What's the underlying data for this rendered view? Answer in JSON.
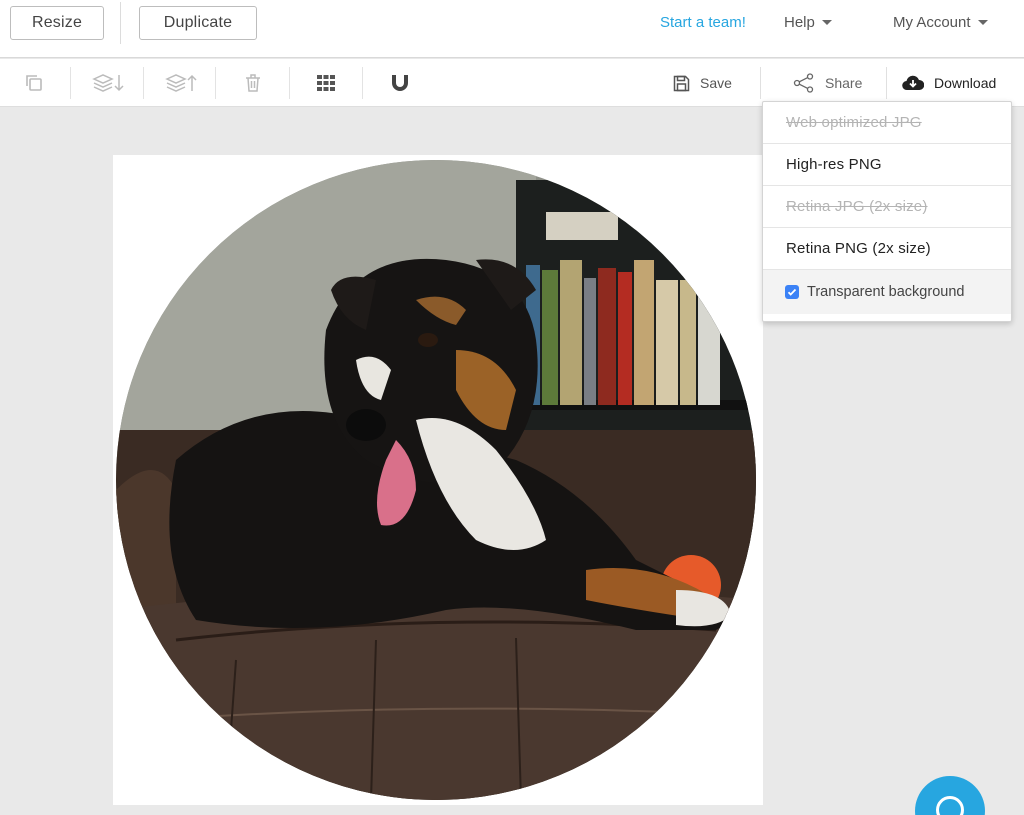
{
  "topbar": {
    "resize_label": "Resize",
    "duplicate_label": "Duplicate",
    "team_link": "Start a team!",
    "help_label": "Help",
    "account_label": "My Account"
  },
  "toolbar": {
    "tools": [
      "copy-icon",
      "layer-down-icon",
      "layer-up-icon",
      "trash-icon",
      "grid-icon",
      "magnet-icon"
    ],
    "save_label": "Save",
    "share_label": "Share",
    "download_label": "Download"
  },
  "download_menu": {
    "items": [
      {
        "label": "Web optimized JPG",
        "disabled": true
      },
      {
        "label": "High-res PNG",
        "disabled": false
      },
      {
        "label": "Retina JPG (2x size)",
        "disabled": true
      },
      {
        "label": "Retina PNG (2x size)",
        "disabled": false
      }
    ],
    "transparent_label": "Transparent background",
    "transparent_checked": true
  },
  "colors": {
    "accent": "#27a6e0",
    "checkbox": "#3b82f6"
  }
}
